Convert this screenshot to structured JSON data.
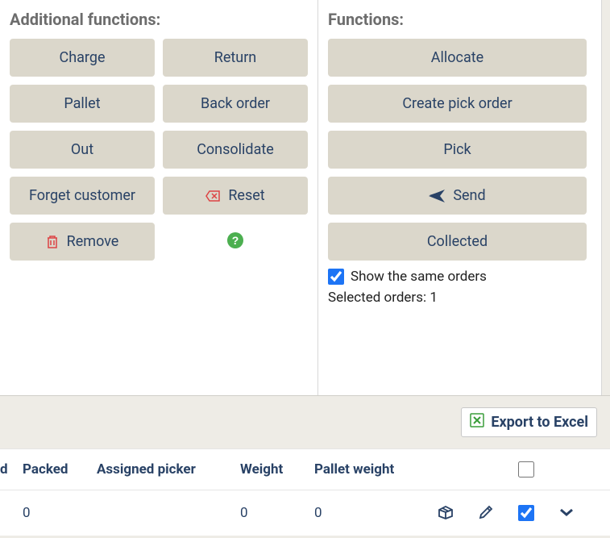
{
  "additional_functions": {
    "title": "Additional functions:",
    "charge": "Charge",
    "return": "Return",
    "pallet": "Pallet",
    "back_order": "Back order",
    "out": "Out",
    "consolidate": "Consolidate",
    "forget_customer": "Forget customer",
    "reset": "Reset",
    "remove": "Remove"
  },
  "functions": {
    "title": "Functions:",
    "allocate": "Allocate",
    "create_pick_order": "Create pick order",
    "pick": "Pick",
    "send": "Send",
    "collected": "Collected",
    "show_same_orders": "Show the same orders",
    "selected_orders_label": "Selected orders: ",
    "selected_orders_count": "1"
  },
  "export": {
    "label": "Export to Excel"
  },
  "table": {
    "headers": {
      "d": "d",
      "packed": "Packed",
      "assigned_picker": "Assigned picker",
      "weight": "Weight",
      "pallet_weight": "Pallet weight"
    },
    "rows": [
      {
        "packed": "0",
        "assigned_picker": "",
        "weight": "0",
        "pallet_weight": "0",
        "checked": true
      }
    ]
  }
}
